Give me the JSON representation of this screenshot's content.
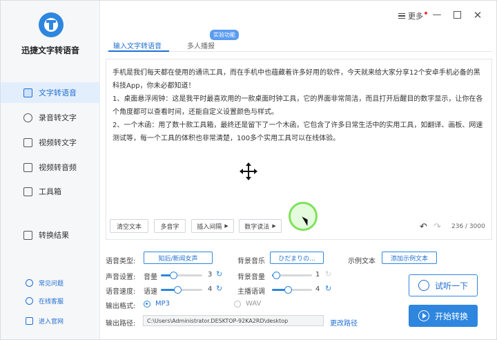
{
  "app": {
    "title": "迅捷文字转语音"
  },
  "titlebar": {
    "more_label": "更多"
  },
  "sidebar": {
    "items": [
      {
        "label": "文字转语音",
        "icon": "text-to-speech-icon"
      },
      {
        "label": "录音转文字",
        "icon": "recording-icon"
      },
      {
        "label": "视频转文字",
        "icon": "video-icon"
      },
      {
        "label": "视频转音频",
        "icon": "video-audio-icon"
      },
      {
        "label": "工具箱",
        "icon": "toolbox-icon"
      },
      {
        "label": "转换结果",
        "icon": "result-icon"
      }
    ],
    "links": [
      {
        "label": "常见问题",
        "icon": "help-icon"
      },
      {
        "label": "在线客服",
        "icon": "support-icon"
      },
      {
        "label": "进入官网",
        "icon": "website-icon"
      }
    ]
  },
  "tabs": [
    {
      "label": "输入文字转语音",
      "active": true
    },
    {
      "label": "多人播报",
      "active": false
    }
  ],
  "badge": "实验功能",
  "editor": {
    "paragraphs": [
      "手机是我们每天都在使用的通讯工具，而在手机中也蕴藏着许多好用的软件，今天就来给大家分享12个安卓手机必备的黑科技App，你未必都知道！",
      "1、桌面悬浮闹钟：这是我平时最喜欢用的一款桌面时钟工具，它的界面非常简洁，而且打开后醒目的数字显示，让你在各个角度都可以查看时间，还能自定义设置颜色与样式。",
      "2、一个木函：用了数十款工具箱，最终还是留下了一个木函，它包含了许多日常生活中的实用工具，如翻译、画板、网速测试等，每一个工具的体积也非常清楚，100多个实用工具可以在线体验。"
    ],
    "buttons": {
      "clear": "清空文本",
      "polyphone": "多音字",
      "pause": "插入间隔",
      "digits": "数字读法"
    },
    "count": "236 / 3000"
  },
  "settings": {
    "voice_type_label": "语音类型:",
    "voice_type_value": "知后/新闻女声",
    "bgm_label": "背景音乐",
    "bgm_value": "ひだまりの...",
    "sample_label": "示例文本",
    "sample_button": "添加示例文本",
    "sound_label": "声音设置:",
    "volume_label": "音量",
    "volume_value": "3",
    "bg_volume_label": "背景音量",
    "bg_volume_value": "1",
    "speed_label": "语音速度:",
    "rate_label": "语速",
    "rate_value": "4",
    "tone_label": "主播语调",
    "tone_value": "4",
    "format_label": "输出格式:",
    "format_mp3": "MP3",
    "format_wav": "WAV",
    "path_label": "输出路径:",
    "path_value": "C:\\Users\\Administrator.DESKTOP-92KA2RD\\desktop",
    "change_path": "更改路径"
  },
  "actions": {
    "preview": "试听一下",
    "start": "开始转换"
  },
  "levels": {
    "volume": 0.3,
    "bg_volume": 0.1,
    "rate": 0.4,
    "tone": 0.4
  },
  "colors": {
    "accent": "#2e86de",
    "active_bg": "#e3eefc"
  }
}
